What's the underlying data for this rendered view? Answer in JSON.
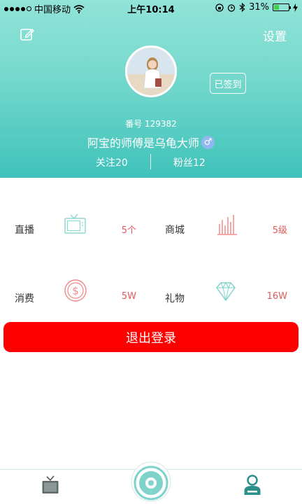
{
  "status_bar": {
    "carrier": "中国移动",
    "time": "上午10:14",
    "battery": "31%",
    "battery_level": 0.31
  },
  "header": {
    "settings_label": "设置",
    "checkin_label": "已签到",
    "user_id": "番号 129382",
    "username": "阿宝的师傅是乌龟大师",
    "gender_symbol": "♂",
    "following": "关注20",
    "fans": "粉丝12"
  },
  "grid": [
    {
      "items": [
        {
          "label": "直播",
          "icon": "tv-icon",
          "value": "5个"
        },
        {
          "label": "商城",
          "icon": "bar-chart-icon",
          "value": "5级"
        }
      ]
    },
    {
      "items": [
        {
          "label": "消费",
          "icon": "dollar-coin-icon",
          "value": "5W"
        },
        {
          "label": "礼物",
          "icon": "diamond-icon",
          "value": "16W"
        }
      ]
    }
  ],
  "logout_label": "退出登录",
  "tabbar": {
    "tabs": [
      "tv-icon",
      "camera-disc-icon",
      "profile-icon"
    ]
  },
  "colors": {
    "header_top": "#92e3d8",
    "header_bottom": "#3fc2ba",
    "accent_red": "#ff0000",
    "value_red": "#e35a5a",
    "teal_icon": "#5cc8c0"
  }
}
